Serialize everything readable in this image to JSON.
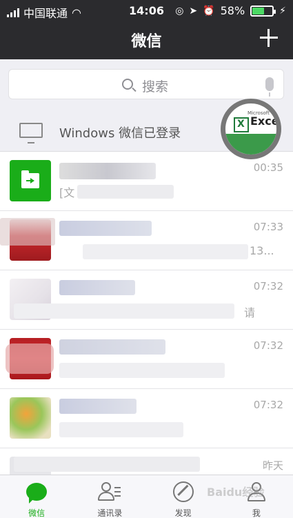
{
  "status_bar": {
    "carrier": "中国联通",
    "time": "14:06",
    "battery": "58%"
  },
  "nav": {
    "title": "微信"
  },
  "search": {
    "placeholder": "搜索"
  },
  "windows_login": {
    "label": "Windows 微信已登录"
  },
  "excel_badge": {
    "vendor": "Microsoft",
    "product": "Excel",
    "icon_letter": "X"
  },
  "chats": [
    {
      "time": "00:35",
      "snippet": "[文"
    },
    {
      "time": "07:33",
      "snippet": "13..."
    },
    {
      "time": "07:32",
      "snippet": "请"
    },
    {
      "time": "07:32",
      "snippet": ""
    },
    {
      "time": "07:32",
      "snippet": ""
    },
    {
      "time": "昨天",
      "snippet": ""
    }
  ],
  "tabs": [
    {
      "label": "微信"
    },
    {
      "label": "通讯录"
    },
    {
      "label": "发现"
    },
    {
      "label": "我"
    }
  ],
  "watermark": "Baidu经验"
}
